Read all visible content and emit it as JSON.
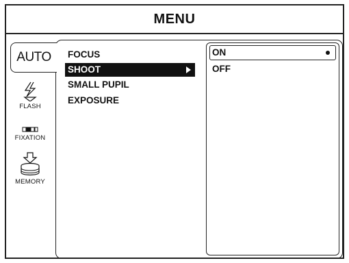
{
  "title": "MENU",
  "tabs": {
    "auto": "AUTO",
    "flash": {
      "label": "FLASH",
      "icon": "flash-icon"
    },
    "fixation": {
      "label": "FIXATION",
      "icon": "fixation-icon"
    },
    "memory": {
      "label": "MEMORY",
      "icon": "memory-icon"
    }
  },
  "menu": {
    "items": [
      {
        "label": "FOCUS"
      },
      {
        "label": "SHOOT",
        "selected": true
      },
      {
        "label": "SMALL PUPIL"
      },
      {
        "label": "EXPOSURE"
      }
    ]
  },
  "options": {
    "items": [
      {
        "label": "ON",
        "selected": true
      },
      {
        "label": "OFF"
      }
    ]
  },
  "colors": {
    "foreground": "#111111",
    "background": "#ffffff"
  }
}
